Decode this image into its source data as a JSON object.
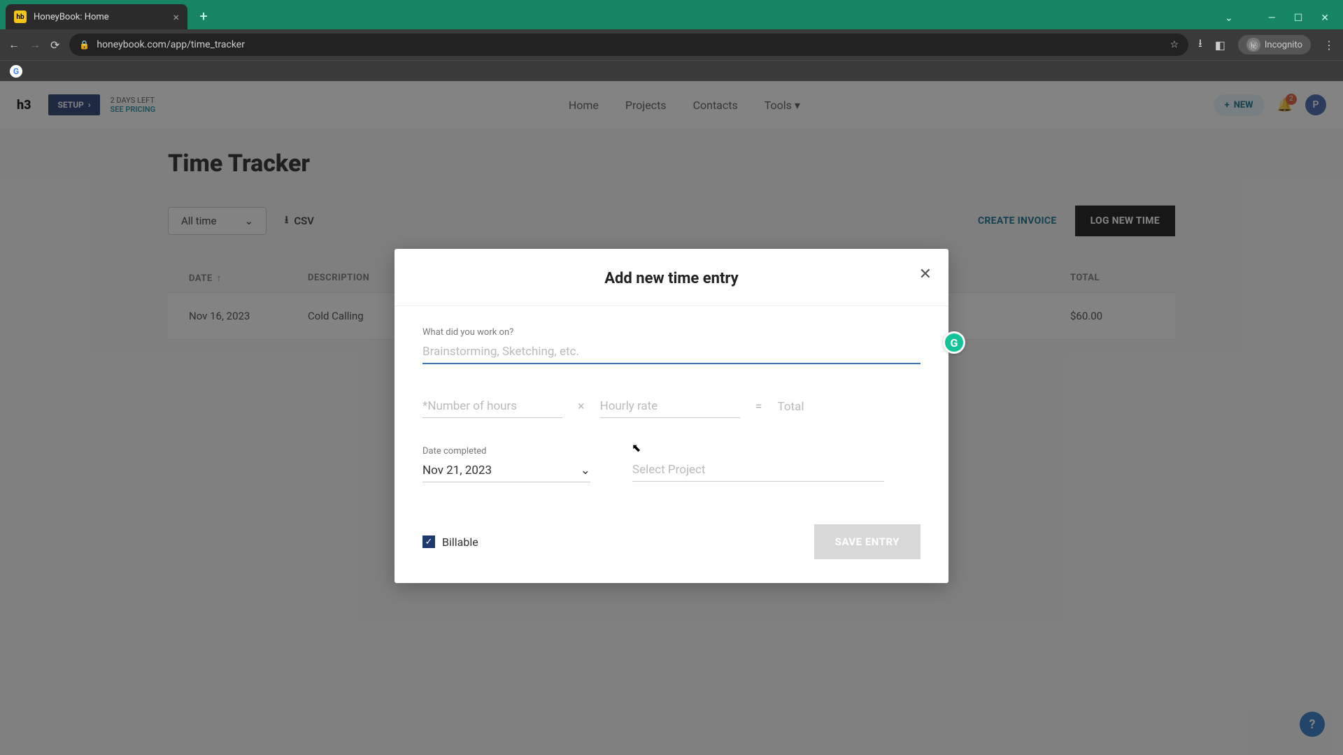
{
  "browser": {
    "tab_title": "HoneyBook: Home",
    "url": "honeybook.com/app/time_tracker",
    "incognito_label": "Incognito"
  },
  "header": {
    "setup_label": "SETUP",
    "trial_line1": "2 DAYS LEFT",
    "trial_line2": "SEE PRICING",
    "nav": {
      "home": "Home",
      "projects": "Projects",
      "contacts": "Contacts",
      "tools": "Tools"
    },
    "new_btn": "NEW",
    "notif_count": "2",
    "avatar_initial": "P"
  },
  "page": {
    "title": "Time Tracker",
    "filter_label": "All time",
    "csv_label": "CSV",
    "create_invoice": "CREATE INVOICE",
    "log_new_time": "LOG NEW TIME",
    "cols": {
      "date": "DATE",
      "desc": "DESCRIPTION",
      "total": "TOTAL"
    },
    "rows": [
      {
        "date": "Nov 16, 2023",
        "desc": "Cold Calling",
        "total": "$60.00"
      }
    ]
  },
  "modal": {
    "title": "Add new time entry",
    "work_label": "What did you work on?",
    "work_placeholder": "Brainstorming, Sketching, etc.",
    "hours_placeholder": "*Number of hours",
    "rate_placeholder": "Hourly rate",
    "total_label": "Total",
    "date_label": "Date completed",
    "date_value": "Nov 21, 2023",
    "project_placeholder": "Select Project",
    "billable_label": "Billable",
    "save_label": "SAVE ENTRY"
  }
}
